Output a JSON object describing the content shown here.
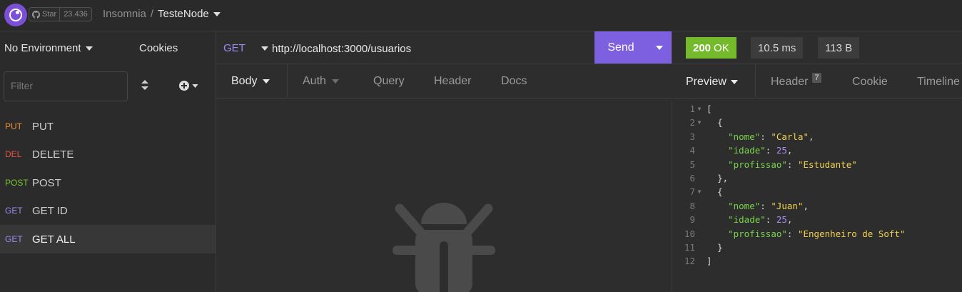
{
  "topbar": {
    "github_star_label": "Star",
    "github_star_count": "23.436",
    "app_name": "Insomnia",
    "separator": "/",
    "project_name": "TesteNode"
  },
  "sidebar": {
    "environment": "No Environment",
    "cookies": "Cookies",
    "filter_placeholder": "Filter",
    "requests": [
      {
        "method": "PUT",
        "name": "PUT",
        "color": "#e8923a"
      },
      {
        "method": "DEL",
        "name": "DELETE",
        "color": "#e05545"
      },
      {
        "method": "POST",
        "name": "POST",
        "color": "#77c62f"
      },
      {
        "method": "GET",
        "name": "GET ID",
        "color": "#9a8cf2"
      },
      {
        "method": "GET",
        "name": "GET ALL",
        "color": "#9a8cf2",
        "active": true
      }
    ]
  },
  "request": {
    "method": "GET",
    "url": "http://localhost:3000/usuarios",
    "send_label": "Send",
    "tabs": [
      "Body",
      "Auth",
      "Query",
      "Header",
      "Docs"
    ]
  },
  "response": {
    "status_code": "200",
    "status_text": "OK",
    "time": "10.5 ms",
    "size": "113 B",
    "tabs": [
      "Preview",
      "Header",
      "Cookie",
      "Timeline"
    ],
    "header_count": "7",
    "lines": [
      {
        "n": "1",
        "fold": true,
        "indent": "",
        "parts": [
          {
            "t": "[",
            "c": "p"
          }
        ]
      },
      {
        "n": "2",
        "fold": true,
        "indent": "  ",
        "parts": [
          {
            "t": "{",
            "c": "p"
          }
        ]
      },
      {
        "n": "3",
        "fold": false,
        "indent": "    ",
        "parts": [
          {
            "t": "\"nome\"",
            "c": "key"
          },
          {
            "t": ": ",
            "c": "p"
          },
          {
            "t": "\"Carla\"",
            "c": "str"
          },
          {
            "t": ",",
            "c": "p"
          }
        ]
      },
      {
        "n": "4",
        "fold": false,
        "indent": "    ",
        "parts": [
          {
            "t": "\"idade\"",
            "c": "key"
          },
          {
            "t": ": ",
            "c": "p"
          },
          {
            "t": "25",
            "c": "num"
          },
          {
            "t": ",",
            "c": "p"
          }
        ]
      },
      {
        "n": "5",
        "fold": false,
        "indent": "    ",
        "parts": [
          {
            "t": "\"profissao\"",
            "c": "key"
          },
          {
            "t": ": ",
            "c": "p"
          },
          {
            "t": "\"Estudante\"",
            "c": "str"
          }
        ]
      },
      {
        "n": "6",
        "fold": false,
        "indent": "  ",
        "parts": [
          {
            "t": "},",
            "c": "p"
          }
        ]
      },
      {
        "n": "7",
        "fold": true,
        "indent": "  ",
        "parts": [
          {
            "t": "{",
            "c": "p"
          }
        ]
      },
      {
        "n": "8",
        "fold": false,
        "indent": "    ",
        "parts": [
          {
            "t": "\"nome\"",
            "c": "key"
          },
          {
            "t": ": ",
            "c": "p"
          },
          {
            "t": "\"Juan\"",
            "c": "str"
          },
          {
            "t": ",",
            "c": "p"
          }
        ]
      },
      {
        "n": "9",
        "fold": false,
        "indent": "    ",
        "parts": [
          {
            "t": "\"idade\"",
            "c": "key"
          },
          {
            "t": ": ",
            "c": "p"
          },
          {
            "t": "25",
            "c": "num"
          },
          {
            "t": ",",
            "c": "p"
          }
        ]
      },
      {
        "n": "10",
        "fold": false,
        "indent": "    ",
        "parts": [
          {
            "t": "\"profissao\"",
            "c": "key"
          },
          {
            "t": ": ",
            "c": "p"
          },
          {
            "t": "\"Engenheiro de Soft\"",
            "c": "str"
          }
        ]
      },
      {
        "n": "11",
        "fold": false,
        "indent": "  ",
        "parts": [
          {
            "t": "}",
            "c": "p"
          }
        ]
      },
      {
        "n": "12",
        "fold": false,
        "indent": "",
        "parts": [
          {
            "t": "]",
            "c": "p"
          }
        ]
      }
    ]
  },
  "icons": [
    "github-icon",
    "bug-icon"
  ]
}
